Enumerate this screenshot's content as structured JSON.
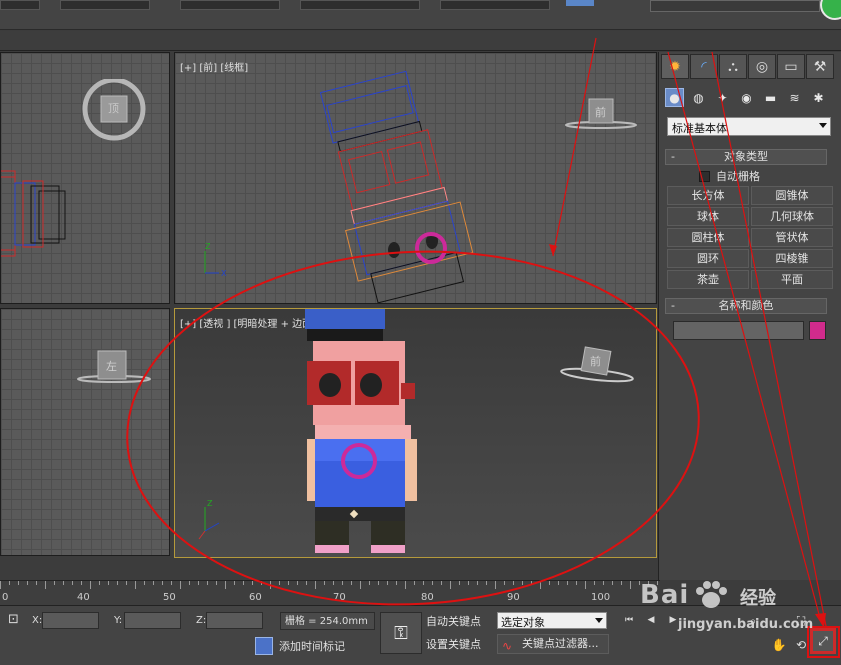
{
  "viewports": {
    "front": {
      "label": "[+] [前] [线框]"
    },
    "perspective": {
      "label": "[+] [透视 ] [明暗处理 + 边面]"
    },
    "top_gizmo": {
      "face": "顶"
    },
    "front_gizmo": {
      "face": "前"
    },
    "left_gizmo": {
      "face": "左"
    },
    "persp_gizmo": {
      "face": "前"
    }
  },
  "command_panel": {
    "tabs": [
      {
        "icon": "sun-icon",
        "glyph": "✹"
      },
      {
        "icon": "modify-icon",
        "glyph": "◜"
      },
      {
        "icon": "hierarchy-icon",
        "glyph": "⛬"
      },
      {
        "icon": "motion-icon",
        "glyph": "◎"
      },
      {
        "icon": "display-icon",
        "glyph": "▭"
      },
      {
        "icon": "utilities-icon",
        "glyph": "⚒"
      }
    ],
    "category_icons": [
      {
        "icon": "geometry-icon",
        "glyph": "●"
      },
      {
        "icon": "shapes-icon",
        "glyph": "◍"
      },
      {
        "icon": "lights-icon",
        "glyph": "✦"
      },
      {
        "icon": "cameras-icon",
        "glyph": "◉"
      },
      {
        "icon": "helpers-icon",
        "glyph": "▬"
      },
      {
        "icon": "spacewarps-icon",
        "glyph": "≋"
      },
      {
        "icon": "systems-icon",
        "glyph": "✱"
      }
    ],
    "dropdown_value": "标准基本体",
    "object_type": {
      "title": "对象类型",
      "collapse": "-",
      "autogrid_label": "自动栅格",
      "buttons": [
        "长方体",
        "圆锥体",
        "球体",
        "几何球体",
        "圆柱体",
        "管状体",
        "圆环",
        "四棱锥",
        "茶壶",
        "平面"
      ]
    },
    "name_color": {
      "title": "名称和颜色",
      "collapse": "-",
      "name_value": "",
      "color": "#d12b8c"
    }
  },
  "timeline": {
    "ticks": [
      "0",
      "40",
      "50",
      "60",
      "70",
      "80",
      "90",
      "100"
    ]
  },
  "statusbar": {
    "x_label": "X:",
    "y_label": "Y:",
    "z_label": "Z:",
    "x_value": "",
    "y_value": "",
    "z_value": "",
    "grid": "栅格 = 254.0mm",
    "add_time_tag": "添加时间标记",
    "auto_key": "自动关键点",
    "set_key": "设置关键点",
    "selection_value": "选定对象",
    "key_filters": "关键点过滤器..."
  },
  "watermark": {
    "logo_left": "Bai",
    "logo_right": "经验",
    "url": "jingyan.baidu.com"
  },
  "colors": {
    "annotation": "#dd1111",
    "selection_accent": "#6a8cc8",
    "perspective_border": "#b59a3c"
  }
}
